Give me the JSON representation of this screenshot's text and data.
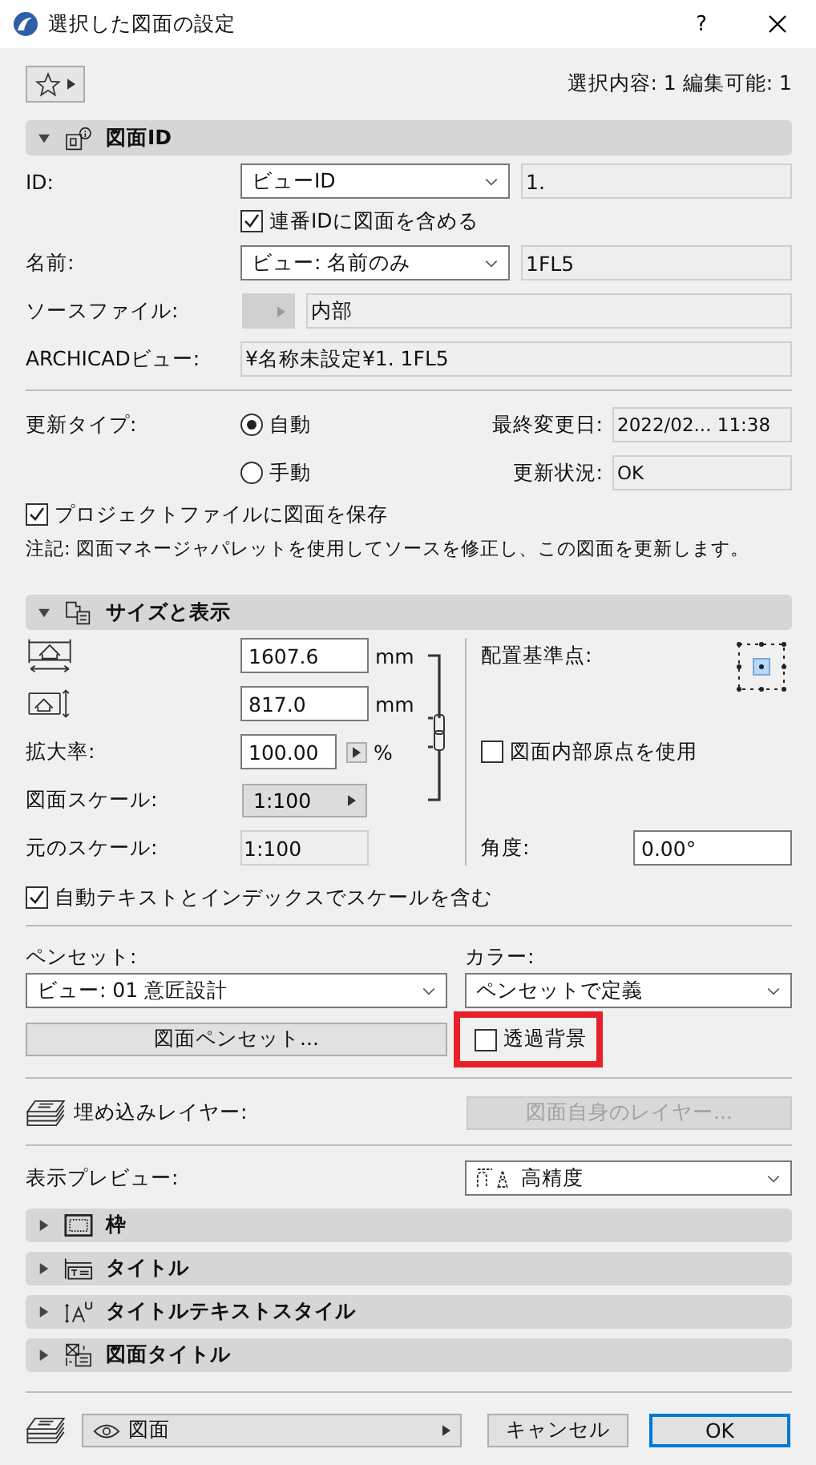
{
  "window": {
    "title": "選択した図面の設定",
    "help": "?"
  },
  "toolbar": {
    "selection_info": "選択内容: 1 編集可能: 1"
  },
  "drawing_id": {
    "title": "図面ID",
    "expanded": true,
    "id_label": "ID:",
    "id_type": "ビューID",
    "id_value": "1.",
    "include_checkbox": {
      "label": "連番IDに図面を含める",
      "checked": true
    },
    "name_label": "名前:",
    "name_type": "ビュー: 名前のみ",
    "name_value": "1FL5",
    "source_label": "ソースファイル:",
    "source_value": "内部",
    "view_label": "ARCHICADビュー:",
    "view_value": "¥名称未設定¥1. 1FL5",
    "update_type_label": "更新タイプ:",
    "update_options": [
      {
        "label": "自動",
        "selected": true
      },
      {
        "label": "手動",
        "selected": false
      }
    ],
    "last_modified_label": "最終変更日:",
    "last_modified_value": "2022/02... 11:38",
    "update_status_label": "更新状況:",
    "update_status_value": "OK",
    "save_checkbox": {
      "label": "プロジェクトファイルに図面を保存",
      "checked": true
    },
    "note": "注記: 図面マネージャパレットを使用してソースを修正し、この図面を更新します。"
  },
  "size_display": {
    "title": "サイズと表示",
    "expanded": true,
    "width_value": "1607.6",
    "width_unit": "mm",
    "height_value": "817.0",
    "height_unit": "mm",
    "scale_label": "拡大率:",
    "scale_value": "100.00",
    "scale_unit": "%",
    "drawing_scale_label": "図面スケール:",
    "drawing_scale_value": "1:100",
    "original_scale_label": "元のスケール:",
    "original_scale_value": "1:100",
    "anchor_label": "配置基準点:",
    "origin_checkbox": {
      "label": "図面内部原点を使用",
      "checked": false
    },
    "angle_label": "角度:",
    "angle_value": "0.00°",
    "autotext_checkbox": {
      "label": "自動テキストとインデックスでスケールを含む",
      "checked": true
    },
    "pen_set_label": "ペンセット:",
    "pen_set_value": "ビュー: 01 意匠設計",
    "color_label": "カラー:",
    "color_value": "ペンセットで定義",
    "pen_set_button": "図面ペンセット...",
    "transparent_checkbox": {
      "label": "透過背景",
      "checked": false,
      "highlighted": true
    },
    "embedded_layer_label": "埋め込みレイヤー:",
    "layer_button": {
      "label": "図面自身のレイヤー...",
      "disabled": true
    },
    "preview_label": "表示プレビュー:",
    "preview_value": "高精度"
  },
  "collapsed_sections": [
    {
      "title": "枠",
      "kind": "frame",
      "expanded": false
    },
    {
      "title": "タイトル",
      "kind": "title",
      "expanded": false
    },
    {
      "title": "タイトルテキストスタイル",
      "kind": "text_style",
      "expanded": false
    },
    {
      "title": "図面タイトル",
      "kind": "drawing_title",
      "expanded": false
    }
  ],
  "footer": {
    "layer_value": "図面",
    "cancel": "キャンセル",
    "ok": "OK"
  }
}
